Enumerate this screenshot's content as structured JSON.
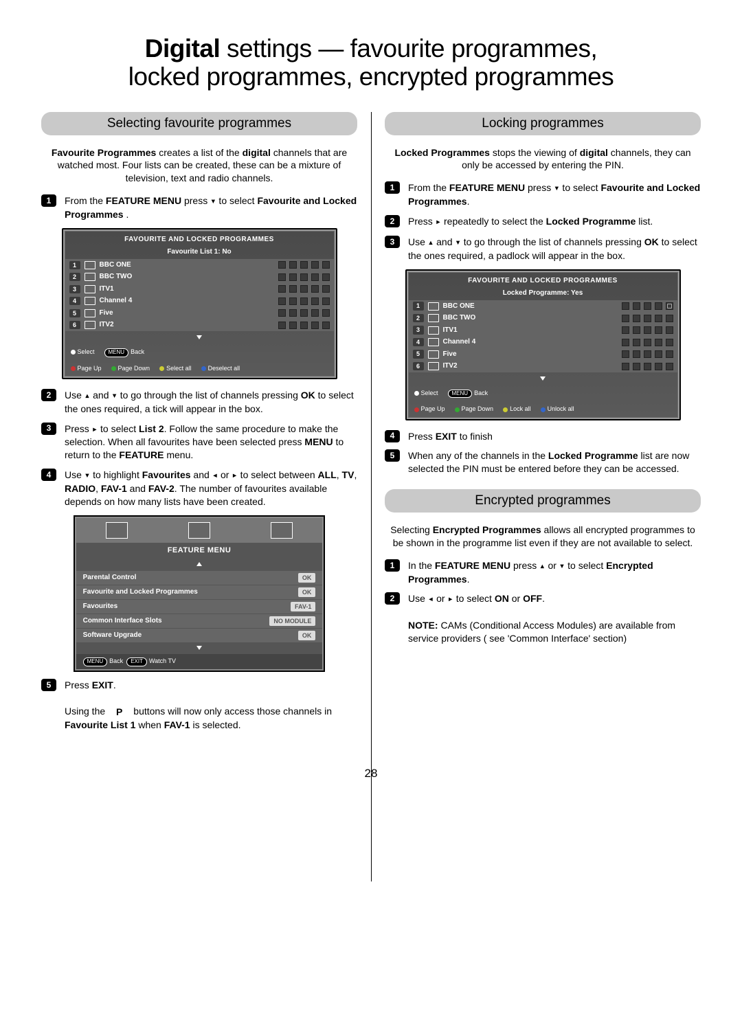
{
  "page_number": "28",
  "title": {
    "line1_bold": "Digital",
    "line1_rest": " settings — favourite programmes,",
    "line2": "locked programmes, encrypted programmes"
  },
  "left": {
    "heading": "Selecting favourite programmes",
    "intro_html": "Favourite Programmes creates a list of the digital channels that are watched most. Four lists can be created, these can be a mixture of television, text and radio channels.",
    "intro_bold1": "Favourite Programmes",
    "intro_bold2": "digital",
    "steps": {
      "1": "From the FEATURE MENU press ▾ to select Favourite and Locked Programmes .",
      "1_b1": "FEATURE MENU",
      "1_b2": "Favourite and Locked Programmes",
      "2": "Use ▴ and ▾ to go through the list of channels pressing OK to select the ones required, a tick will appear in the box.",
      "2_b1": "OK",
      "3": "Press ▸ to select List 2. Follow the same procedure to make the selection. When all favourites have been selected press MENU to return to the FEATURE menu.",
      "3_b1": "List 2",
      "3_b2": "MENU",
      "3_b3": "FEATURE",
      "4": "Use ▾ to highlight Favourites and ◂ or ▸ to select between ALL, TV, RADIO, FAV-1 and FAV-2. The number of favourites available depends on how many lists have been created.",
      "4_b1": "Favourites",
      "4_b2": "ALL",
      "4_b3": "TV",
      "4_b4": "RADIO",
      "4_b5": "FAV-1",
      "4_b6": "FAV-2",
      "5a": "Press EXIT.",
      "5a_b": "EXIT",
      "5b": "Using the ▴ P ▾ buttons will now only access those channels in Favourite List 1 when FAV-1 is selected.",
      "5b_b1": "P",
      "5b_b2": "Favourite List 1",
      "5b_b3": "FAV-1"
    },
    "osd1": {
      "title": "FAVOURITE AND LOCKED PROGRAMMES",
      "sub": "Favourite List 1: No",
      "rows": [
        {
          "n": "1",
          "name": "BBC ONE"
        },
        {
          "n": "2",
          "name": "BBC TWO"
        },
        {
          "n": "3",
          "name": "ITV1"
        },
        {
          "n": "4",
          "name": "Channel 4"
        },
        {
          "n": "5",
          "name": "Five"
        },
        {
          "n": "6",
          "name": "ITV2"
        }
      ],
      "footer": {
        "select": "Select",
        "menu": "MENU",
        "back": "Back",
        "pageup": "Page Up",
        "pagedown": "Page Down",
        "selectall": "Select all",
        "deselectall": "Deselect all"
      }
    },
    "feature_menu": {
      "title": "FEATURE MENU",
      "rows": [
        {
          "label": "Parental Control",
          "tag": "OK"
        },
        {
          "label": "Favourite and Locked Programmes",
          "tag": "OK"
        },
        {
          "label": "Favourites",
          "tag": "FAV-1"
        },
        {
          "label": "Common Interface Slots",
          "tag": "NO MODULE"
        },
        {
          "label": "Software Upgrade",
          "tag": "OK"
        }
      ],
      "footer": {
        "menu": "MENU",
        "back": "Back",
        "exit": "EXIT",
        "watch": "Watch TV"
      }
    }
  },
  "right": {
    "heading1": "Locking programmes",
    "intro1_bold": "Locked Programmes",
    "intro1_bold2": "digital",
    "intro1": "Locked Programmes stops the viewing of digital channels, they can only be accessed by entering the PIN.",
    "steps1": {
      "1": "From the FEATURE MENU press ▾ to select Favourite and Locked Programmes.",
      "1_b1": "FEATURE MENU",
      "1_b2": "Favourite and Locked Programmes",
      "2": "Press ▸ repeatedly to select the Locked Programme list.",
      "2_b1": "Locked Programme",
      "3": "Use ▴ and ▾ to go through the list of channels pressing OK to select the ones required, a padlock will appear in the box.",
      "3_b1": "OK",
      "4": "Press EXIT to finish",
      "4_b": "EXIT",
      "5": "When any of the channels in the Locked Programme list are now selected the PIN must be entered before they can be accessed.",
      "5_b": "Locked Programme"
    },
    "osd2": {
      "title": "FAVOURITE AND LOCKED PROGRAMMES",
      "sub": "Locked Programme: Yes",
      "rows": [
        {
          "n": "1",
          "name": "BBC ONE",
          "lock": true
        },
        {
          "n": "2",
          "name": "BBC TWO"
        },
        {
          "n": "3",
          "name": "ITV1"
        },
        {
          "n": "4",
          "name": "Channel 4"
        },
        {
          "n": "5",
          "name": "Five"
        },
        {
          "n": "6",
          "name": "ITV2"
        }
      ],
      "footer": {
        "select": "Select",
        "menu": "MENU",
        "back": "Back",
        "pageup": "Page Up",
        "pagedown": "Page Down",
        "lockall": "Lock all",
        "unlockall": "Unlock all"
      }
    },
    "heading2": "Encrypted programmes",
    "intro2": "Selecting Encrypted Programmes allows all encrypted programmes to be shown in the programme list even if they are not available to select.",
    "intro2_bold": "Encrypted Programmes",
    "steps2": {
      "1": "In the FEATURE MENU press ▴ or ▾ to select Encrypted Programmes.",
      "1_b1": "FEATURE MENU",
      "1_b2": "Encrypted Programmes",
      "2": "Use ◂ or ▸ to select ON or OFF.",
      "2_b1": "ON",
      "2_b2": "OFF",
      "note": "NOTE: CAMs (Conditional Access Modules) are available from service providers ( see 'Common Interface' section)",
      "note_b": "NOTE:"
    }
  }
}
